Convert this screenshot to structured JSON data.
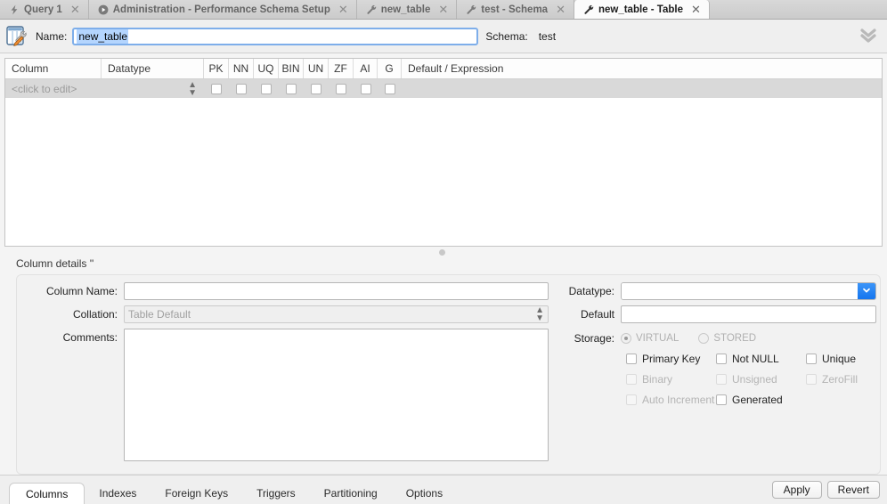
{
  "tabs": [
    {
      "label": "Query 1",
      "icon": "lightning-icon",
      "active": false,
      "closable": true
    },
    {
      "label": "Administration - Performance Schema Setup",
      "icon": "play-circle-icon",
      "active": false,
      "closable": true
    },
    {
      "label": "new_table",
      "icon": "wrench-icon",
      "active": false,
      "closable": true
    },
    {
      "label": "test - Schema",
      "icon": "wrench-icon",
      "active": false,
      "closable": true
    },
    {
      "label": "new_table - Table",
      "icon": "wrench-icon",
      "active": true,
      "closable": true
    }
  ],
  "header": {
    "icon": "table-edit-icon",
    "name_label": "Name:",
    "name_value": "new_table",
    "schema_label": "Schema:",
    "schema_value": "test",
    "collapse_icon": "double-chevron-down-icon"
  },
  "grid": {
    "headers": [
      "Column",
      "Datatype",
      "PK",
      "NN",
      "UQ",
      "BIN",
      "UN",
      "ZF",
      "AI",
      "G",
      "Default / Expression"
    ],
    "rows": [
      {
        "column": "<click to edit>",
        "datatype": "",
        "flags": [
          false,
          false,
          false,
          false,
          false,
          false,
          false,
          false
        ],
        "default": ""
      }
    ]
  },
  "details": {
    "title": "Column details ''",
    "column_name_label": "Column Name:",
    "column_name_value": "",
    "collation_label": "Collation:",
    "collation_value": "Table Default",
    "comments_label": "Comments:",
    "comments_value": "",
    "datatype_label": "Datatype:",
    "datatype_value": "",
    "default_label": "Default",
    "default_value": "",
    "storage_label": "Storage:",
    "storage_options": [
      {
        "label": "VIRTUAL",
        "selected": true,
        "disabled": true
      },
      {
        "label": "STORED",
        "selected": false,
        "disabled": true
      }
    ],
    "flags": [
      [
        {
          "label": "Primary Key",
          "checked": false,
          "disabled": false
        },
        {
          "label": "Not NULL",
          "checked": false,
          "disabled": false
        },
        {
          "label": "Unique",
          "checked": false,
          "disabled": false
        }
      ],
      [
        {
          "label": "Binary",
          "checked": false,
          "disabled": true
        },
        {
          "label": "Unsigned",
          "checked": false,
          "disabled": true
        },
        {
          "label": "ZeroFill",
          "checked": false,
          "disabled": true
        }
      ],
      [
        {
          "label": "Auto Increment",
          "checked": false,
          "disabled": true
        },
        {
          "label": "Generated",
          "checked": false,
          "disabled": false
        }
      ]
    ]
  },
  "bottom": {
    "tabs": [
      {
        "label": "Columns",
        "active": true
      },
      {
        "label": "Indexes",
        "active": false
      },
      {
        "label": "Foreign Keys",
        "active": false
      },
      {
        "label": "Triggers",
        "active": false
      },
      {
        "label": "Partitioning",
        "active": false
      },
      {
        "label": "Options",
        "active": false
      }
    ],
    "apply_label": "Apply",
    "revert_label": "Revert"
  },
  "colors": {
    "accent_blue": "#1575ef",
    "selection_blue": "#b4d5fe",
    "focus_border": "#7eaeea",
    "row_gray": "#d9d9d9"
  }
}
